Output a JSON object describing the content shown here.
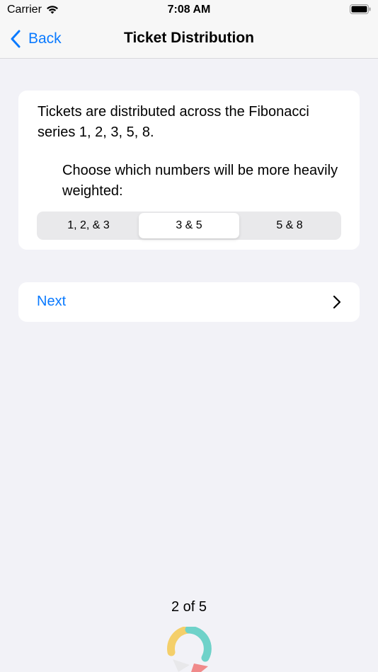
{
  "status_bar": {
    "carrier": "Carrier",
    "time": "7:08 AM"
  },
  "nav": {
    "back_label": "Back",
    "title": "Ticket Distribution"
  },
  "card": {
    "description": "Tickets are distributed across the Fibonacci series 1, 2, 3, 5, 8.",
    "prompt": "Choose which numbers will be more heavily weighted:",
    "segments": [
      "1, 2, & 3",
      "3 & 5",
      "5 & 8"
    ],
    "selected_segment": "3 & 5"
  },
  "next_row": {
    "label": "Next"
  },
  "footer": {
    "page_indicator": "2 of 5"
  },
  "colors": {
    "accent": "#0a7aff",
    "background": "#f2f2f7",
    "logo_yellow": "#f4cf6a",
    "logo_teal": "#6fd2c9",
    "logo_pink": "#f08a8a"
  }
}
